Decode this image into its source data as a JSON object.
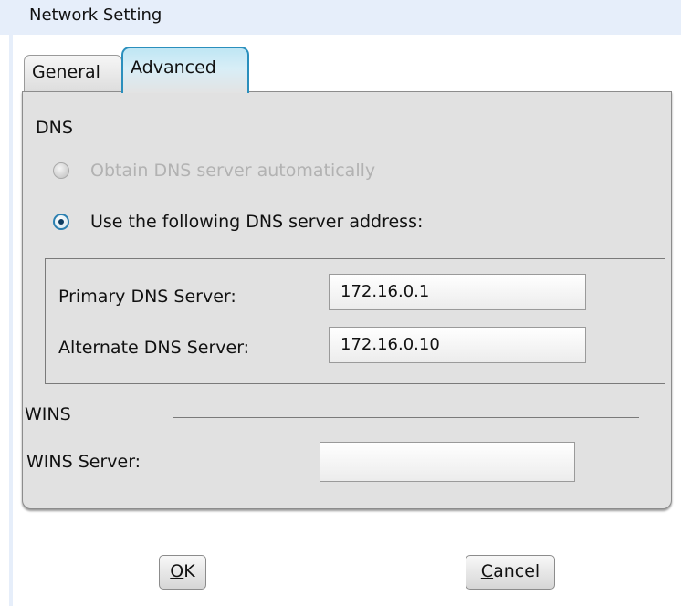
{
  "window": {
    "title": "Network Setting"
  },
  "tabs": [
    {
      "label": "General",
      "active": false
    },
    {
      "label": "Advanced",
      "active": true
    }
  ],
  "dns": {
    "section_label": "DNS",
    "option_auto": {
      "label": "Obtain DNS server automatically",
      "selected": false,
      "enabled": false
    },
    "option_manual": {
      "label": "Use the following DNS server address:",
      "selected": true,
      "enabled": true
    },
    "primary": {
      "label": "Primary DNS Server:",
      "value": "172.16.0.1"
    },
    "alternate": {
      "label": "Alternate DNS Server:",
      "value": "172.16.0.10"
    }
  },
  "wins": {
    "section_label": "WINS",
    "server": {
      "label": "WINS Server:",
      "value": ""
    }
  },
  "buttons": {
    "ok": {
      "mnemonic": "O",
      "rest": "K"
    },
    "cancel": {
      "mnemonic": "C",
      "rest": "ancel"
    }
  },
  "colors": {
    "accent": "#2a8fbd",
    "panel_bg": "#e1e1e1",
    "titlebar_bg": "#e6eefa"
  }
}
